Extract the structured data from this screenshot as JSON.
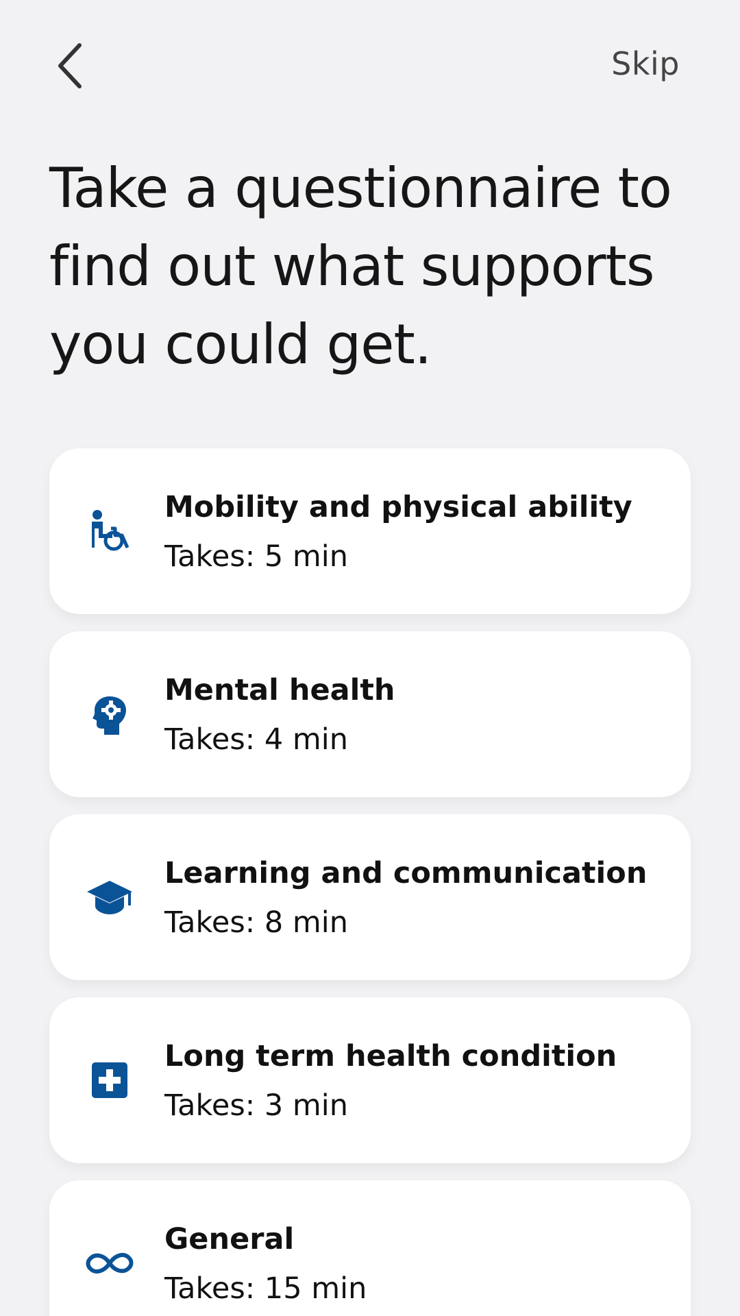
{
  "header": {
    "back_icon": "chevron-left-icon",
    "skip_label": "Skip"
  },
  "title": "Take a questionnaire to find out what supports you could get.",
  "accent_color": "#0b5397",
  "questionnaires": [
    {
      "icon": "wheelchair-icon",
      "title": "Mobility and physical ability",
      "duration": "Takes: 5 min"
    },
    {
      "icon": "head-gear-icon",
      "title": "Mental health",
      "duration": "Takes: 4 min"
    },
    {
      "icon": "graduation-cap-icon",
      "title": "Learning and communication",
      "duration": "Takes: 8 min"
    },
    {
      "icon": "medical-cross-icon",
      "title": "Long term health condition",
      "duration": "Takes: 3 min"
    },
    {
      "icon": "infinity-icon",
      "title": "General",
      "duration": "Takes: 15 min"
    }
  ]
}
